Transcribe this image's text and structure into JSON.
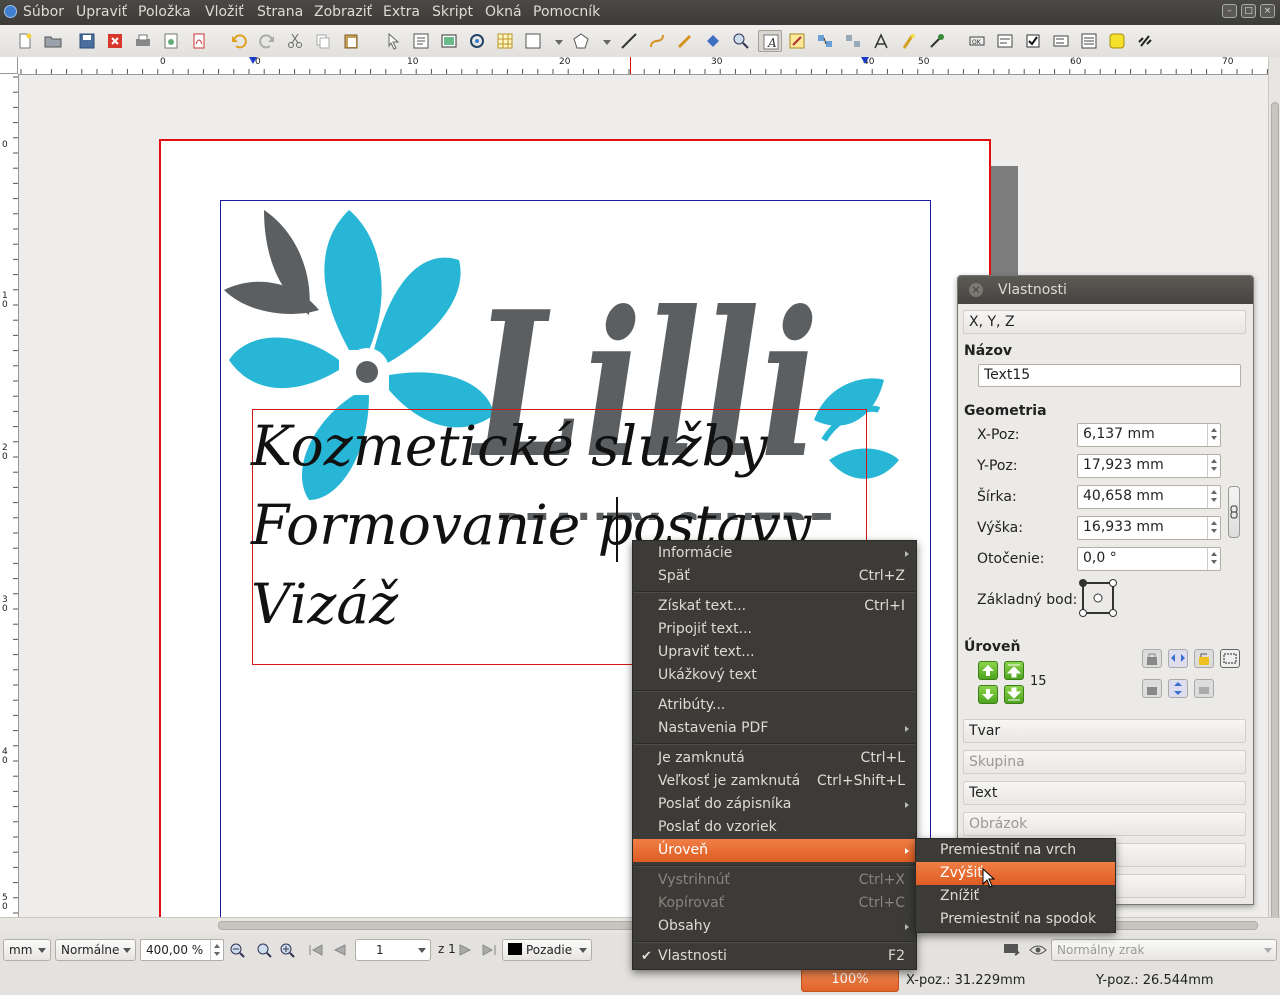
{
  "menubar": {
    "items": [
      "Súbor",
      "Upraviť",
      "Položka",
      "Vložiť",
      "Strana",
      "Zobraziť",
      "Extra",
      "Skript",
      "Okná",
      "Pomocník"
    ]
  },
  "ruler": {
    "h_labels": [
      "0",
      "0",
      "10",
      "20",
      "30",
      "40",
      "50",
      "60",
      "70"
    ],
    "v_labels": [
      "0",
      "1\n0",
      "2\n0",
      "3\n0",
      "4\n0",
      "5\n0"
    ]
  },
  "document": {
    "logo_text": "Lilli",
    "logo_subtext": "BEAUTY CENTRE",
    "text_lines": [
      "Kozmetické služby",
      "Formovanie postavy",
      "Vizáž"
    ]
  },
  "properties": {
    "title": "Vlastnosti",
    "xyz_section": "X, Y, Z",
    "name_label": "Názov",
    "name_value": "Text15",
    "geometry_label": "Geometria",
    "xpos_label": "X-Poz:",
    "xpos_value": "6,137 mm",
    "ypos_label": "Y-Poz:",
    "ypos_value": "17,923 mm",
    "width_label": "Šírka:",
    "width_value": "40,658 mm",
    "height_label": "Výška:",
    "height_value": "16,933 mm",
    "rotation_label": "Otočenie:",
    "rotation_value": "0,0 °",
    "basepoint_label": "Základný bod:",
    "level_label": "Úroveň",
    "level_value": "15",
    "sections": [
      "Tvar",
      "Skupina",
      "Text",
      "Obrázok"
    ]
  },
  "context_menu": {
    "items": [
      {
        "label": "Informácie",
        "shortcut": "",
        "submenu": true,
        "disabled": false
      },
      {
        "label": "Späť",
        "shortcut": "Ctrl+Z",
        "submenu": false,
        "disabled": false
      },
      {
        "label": "Získať text...",
        "shortcut": "Ctrl+I",
        "submenu": false,
        "disabled": false
      },
      {
        "label": "Pripojiť text...",
        "shortcut": "",
        "submenu": false,
        "disabled": false
      },
      {
        "label": "Upraviť text...",
        "shortcut": "",
        "submenu": false,
        "disabled": false
      },
      {
        "label": "Ukážkový text",
        "shortcut": "",
        "submenu": false,
        "disabled": false
      },
      {
        "label": "Atribúty...",
        "shortcut": "",
        "submenu": false,
        "disabled": false
      },
      {
        "label": "Nastavenia PDF",
        "shortcut": "",
        "submenu": true,
        "disabled": false
      },
      {
        "label": "Je zamknutá",
        "shortcut": "Ctrl+L",
        "submenu": false,
        "disabled": false
      },
      {
        "label": "Veľkosť je zamknutá",
        "shortcut": "Ctrl+Shift+L",
        "submenu": false,
        "disabled": false
      },
      {
        "label": "Poslať do zápisníka",
        "shortcut": "",
        "submenu": true,
        "disabled": false
      },
      {
        "label": "Poslať do vzoriek",
        "shortcut": "",
        "submenu": false,
        "disabled": false
      },
      {
        "label": "Úroveň",
        "shortcut": "",
        "submenu": true,
        "disabled": false
      },
      {
        "label": "Vystrihnúť",
        "shortcut": "Ctrl+X",
        "submenu": false,
        "disabled": true
      },
      {
        "label": "Kopírovať",
        "shortcut": "Ctrl+C",
        "submenu": false,
        "disabled": true
      },
      {
        "label": "Obsahy",
        "shortcut": "",
        "submenu": true,
        "disabled": false
      },
      {
        "label": "Vlastnosti",
        "shortcut": "F2",
        "submenu": false,
        "disabled": false,
        "checked": true
      }
    ]
  },
  "level_submenu": {
    "items": [
      "Premiestniť na vrch",
      "Zvýšiť",
      "Znížiť",
      "Premiestniť na spodok"
    ]
  },
  "statusbar": {
    "unit": "mm",
    "quality": "Normálne",
    "zoom": "400,00 %",
    "page": "1",
    "page_of": "z 1",
    "layer": "Pozadie",
    "view_mode": "Normálny zrak",
    "progress": "100%",
    "xpos": "X-poz.: 31.229mm",
    "ypos": "Y-poz.: 26.544mm"
  },
  "colors": {
    "accent": "#e8692f",
    "logo_blue": "#27b6d6",
    "logo_gray": "#5c5f61",
    "page_border": "#e01010",
    "margin_guide": "#1a1aa0"
  }
}
